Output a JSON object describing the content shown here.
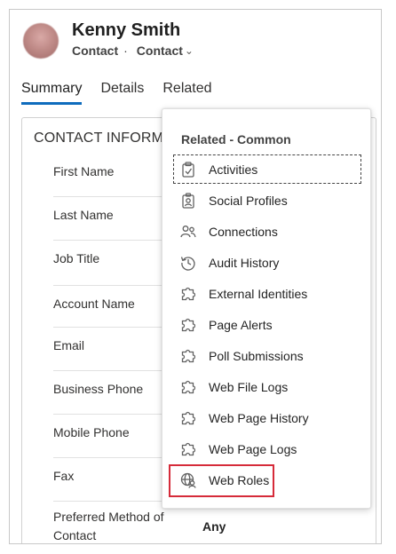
{
  "record": {
    "name": "Kenny Smith",
    "entity": "Contact",
    "form": "Contact"
  },
  "tabs": [
    "Summary",
    "Details",
    "Related"
  ],
  "section": {
    "title": "CONTACT INFORMATION"
  },
  "fields": [
    {
      "label": "First Name"
    },
    {
      "label": "Last Name"
    },
    {
      "label": "Job Title"
    },
    {
      "label": "Account Name"
    },
    {
      "label": "Email"
    },
    {
      "label": "Business Phone"
    },
    {
      "label": "Mobile Phone"
    },
    {
      "label": "Fax"
    },
    {
      "label": "Preferred Method of Contact",
      "value": "Any"
    }
  ],
  "related_menu": {
    "header": "Related - Common",
    "items": [
      {
        "label": "Activities",
        "icon": "clipboard-icon"
      },
      {
        "label": "Social Profiles",
        "icon": "profile-badge-icon"
      },
      {
        "label": "Connections",
        "icon": "people-icon"
      },
      {
        "label": "Audit History",
        "icon": "history-icon"
      },
      {
        "label": "External Identities",
        "icon": "puzzle-icon"
      },
      {
        "label": "Page Alerts",
        "icon": "puzzle-icon"
      },
      {
        "label": "Poll Submissions",
        "icon": "puzzle-icon"
      },
      {
        "label": "Web File Logs",
        "icon": "puzzle-icon"
      },
      {
        "label": "Web Page History",
        "icon": "puzzle-icon"
      },
      {
        "label": "Web Page Logs",
        "icon": "puzzle-icon"
      },
      {
        "label": "Web Roles",
        "icon": "globe-person-icon"
      }
    ]
  },
  "colors": {
    "accent": "#0f6cbd",
    "highlight": "#d62b3a"
  }
}
